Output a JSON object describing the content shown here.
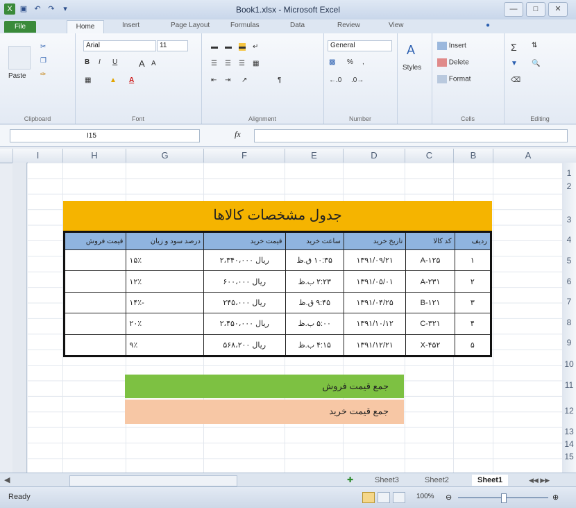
{
  "window": {
    "title": "Book1.xlsx - Microsoft Excel"
  },
  "ribbon_tabs": [
    "Home",
    "Insert",
    "Page Layout",
    "Formulas",
    "Data",
    "Review",
    "View"
  ],
  "file_tab": "File",
  "ribbon": {
    "font_name": "Arial",
    "font_size": "11",
    "number_format": "General",
    "paste_label": "Paste",
    "styles_label": "Styles",
    "insert_label": "Insert",
    "delete_label": "Delete",
    "format_label": "Format",
    "groups": [
      "Clipboard",
      "Font",
      "Alignment",
      "Number",
      "Cells",
      "Editing"
    ]
  },
  "formula_bar": {
    "name_box": "I15",
    "fx": "fx",
    "formula": ""
  },
  "columns": [
    "I",
    "H",
    "G",
    "F",
    "E",
    "D",
    "C",
    "B",
    "A"
  ],
  "rows": [
    "1",
    "2",
    "3",
    "4",
    "5",
    "6",
    "7",
    "8",
    "9",
    "10",
    "11",
    "12",
    "13",
    "14",
    "15"
  ],
  "table": {
    "title": "جدول مشخصات کالاها",
    "headers": [
      "ردیف",
      "کد کالا",
      "تاریخ خرید",
      "ساعت خرید",
      "قیمت خرید",
      "درصد سود و زیان",
      "قیمت فروش"
    ],
    "rows": [
      {
        "id": "۱",
        "code": "A-۱۲۵",
        "date": "۱۳۹۱/۰۹/۲۱",
        "time": "۱۰:۳۵ ق.ظ",
        "price": "ریال ۲،۳۴۰،۰۰۰",
        "pct": "۱۵٪",
        "sale": ""
      },
      {
        "id": "۲",
        "code": "A-۲۳۱",
        "date": "۱۳۹۱/۰۵/۰۱",
        "time": "۲:۲۳ ب.ظ",
        "price": "ریال ۶۰۰،۰۰۰",
        "pct": "۱۲٪",
        "sale": ""
      },
      {
        "id": "۳",
        "code": "B-۱۲۱",
        "date": "۱۳۹۱/۰۴/۲۵",
        "time": "۹:۴۵ ق.ظ",
        "price": "ریال ۲۴۵،۰۰۰",
        "pct": "-۱۴٪",
        "sale": ""
      },
      {
        "id": "۴",
        "code": "C-۳۲۱",
        "date": "۱۳۹۱/۱۰/۱۲",
        "time": "۵:۰۰ ب.ظ",
        "price": "ریال ۲،۴۵۰،۰۰۰",
        "pct": "۲۰٪",
        "sale": ""
      },
      {
        "id": "۵",
        "code": "X-۴۵۲",
        "date": "۱۳۹۱/۱۲/۲۱",
        "time": "۴:۱۵ ب.ظ",
        "price": "ریال ۵۶۸،۲۰۰",
        "pct": "۹٪",
        "sale": ""
      }
    ]
  },
  "summary": {
    "sale_total": "جمع قیمت فروش",
    "buy_total": "جمع قیمت خرید"
  },
  "sheets": [
    "Sheet3",
    "Sheet2",
    "Sheet1"
  ],
  "status": {
    "ready": "Ready",
    "zoom": "100%"
  }
}
